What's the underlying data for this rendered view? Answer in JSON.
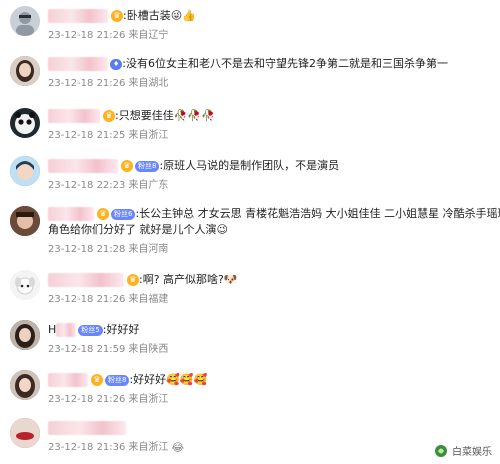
{
  "comments": [
    {
      "avatar_color": "#c9cfd6",
      "avatar_icon": "person-gray-avatar",
      "name_width": 60,
      "badge": "crown",
      "text": ":卧槽古装",
      "emojis": [
        "😜",
        "👍"
      ],
      "time": "23-12-18 21:26",
      "location": "来自辽宁"
    },
    {
      "avatar_color": "#7a5a4a",
      "avatar_icon": "woman-avatar",
      "name_width": 60,
      "badge": "",
      "text": ":没有6位女主和老八不是去和守望先锋2争第二就是和三国杀争第一",
      "emojis": [],
      "time": "23-12-18 21:26",
      "location": "来自湖北"
    },
    {
      "avatar_color": "#1f2a2e",
      "avatar_icon": "panda-avatar",
      "name_width": 52,
      "badge": "crown",
      "text": ":只想要佳佳",
      "emojis": [
        "🥀",
        "🥀",
        "🥀"
      ],
      "time": "23-12-18 21:25",
      "location": "来自浙江"
    },
    {
      "avatar_color": "#2f6ea5",
      "avatar_icon": "anime-boy-avatar",
      "name_width": 70,
      "badge": "crown",
      "fan_label": "粉丝8",
      "text": ":原班人马说的是制作团队，不是演员",
      "emojis": [],
      "time": "23-12-18 22:23",
      "location": "来自广东"
    },
    {
      "avatar_color": "#5b3b2e",
      "avatar_icon": "man-avatar",
      "name_width": 46,
      "badge": "crown",
      "fan_label": "粉丝6",
      "text": ":长公主钟总 才女云思 青楼花魁浩浩妈 大小姐佳佳 二小姐慧星 冷酷杀手瑶瑶",
      "text2": "角色给你们分好了 就好是儿个人演",
      "emojis": [
        "😉"
      ],
      "time": "23-12-18 21:28",
      "location": "来自河南"
    },
    {
      "avatar_color": "#e6e6e6",
      "avatar_icon": "puppy-avatar",
      "name_width": 76,
      "badge": "crown",
      "text": ":啊? 高产似那啥?",
      "emojis": [
        "🐶"
      ],
      "time": "23-12-18 21:26",
      "location": "来自福建"
    },
    {
      "avatar_color": "#3a2f2a",
      "avatar_icon": "woman-dark-avatar",
      "name_width": 20,
      "prefix": "H",
      "badge": "",
      "fan_label": "粉丝5",
      "text": ":好好好",
      "emojis": [],
      "time": "23-12-18 21:59",
      "location": "来自陕西"
    },
    {
      "avatar_color": "#8a5e4a",
      "avatar_icon": "woman-avatar",
      "name_width": 40,
      "badge": "crown",
      "fan_label": "粉丝8",
      "text": ":好好好",
      "emojis": [
        "🥰",
        "🥰",
        "🥰"
      ],
      "time": "23-12-18 21:26",
      "location": "来自浙江"
    },
    {
      "avatar_color": "#c0392b",
      "avatar_icon": "lips-avatar",
      "name_width": 78,
      "badge": "",
      "text": "",
      "emojis": [
        "😂"
      ],
      "time": "23-12-18 21:36",
      "location": "来自浙江"
    }
  ],
  "footer": {
    "label": "白菜娱乐"
  }
}
